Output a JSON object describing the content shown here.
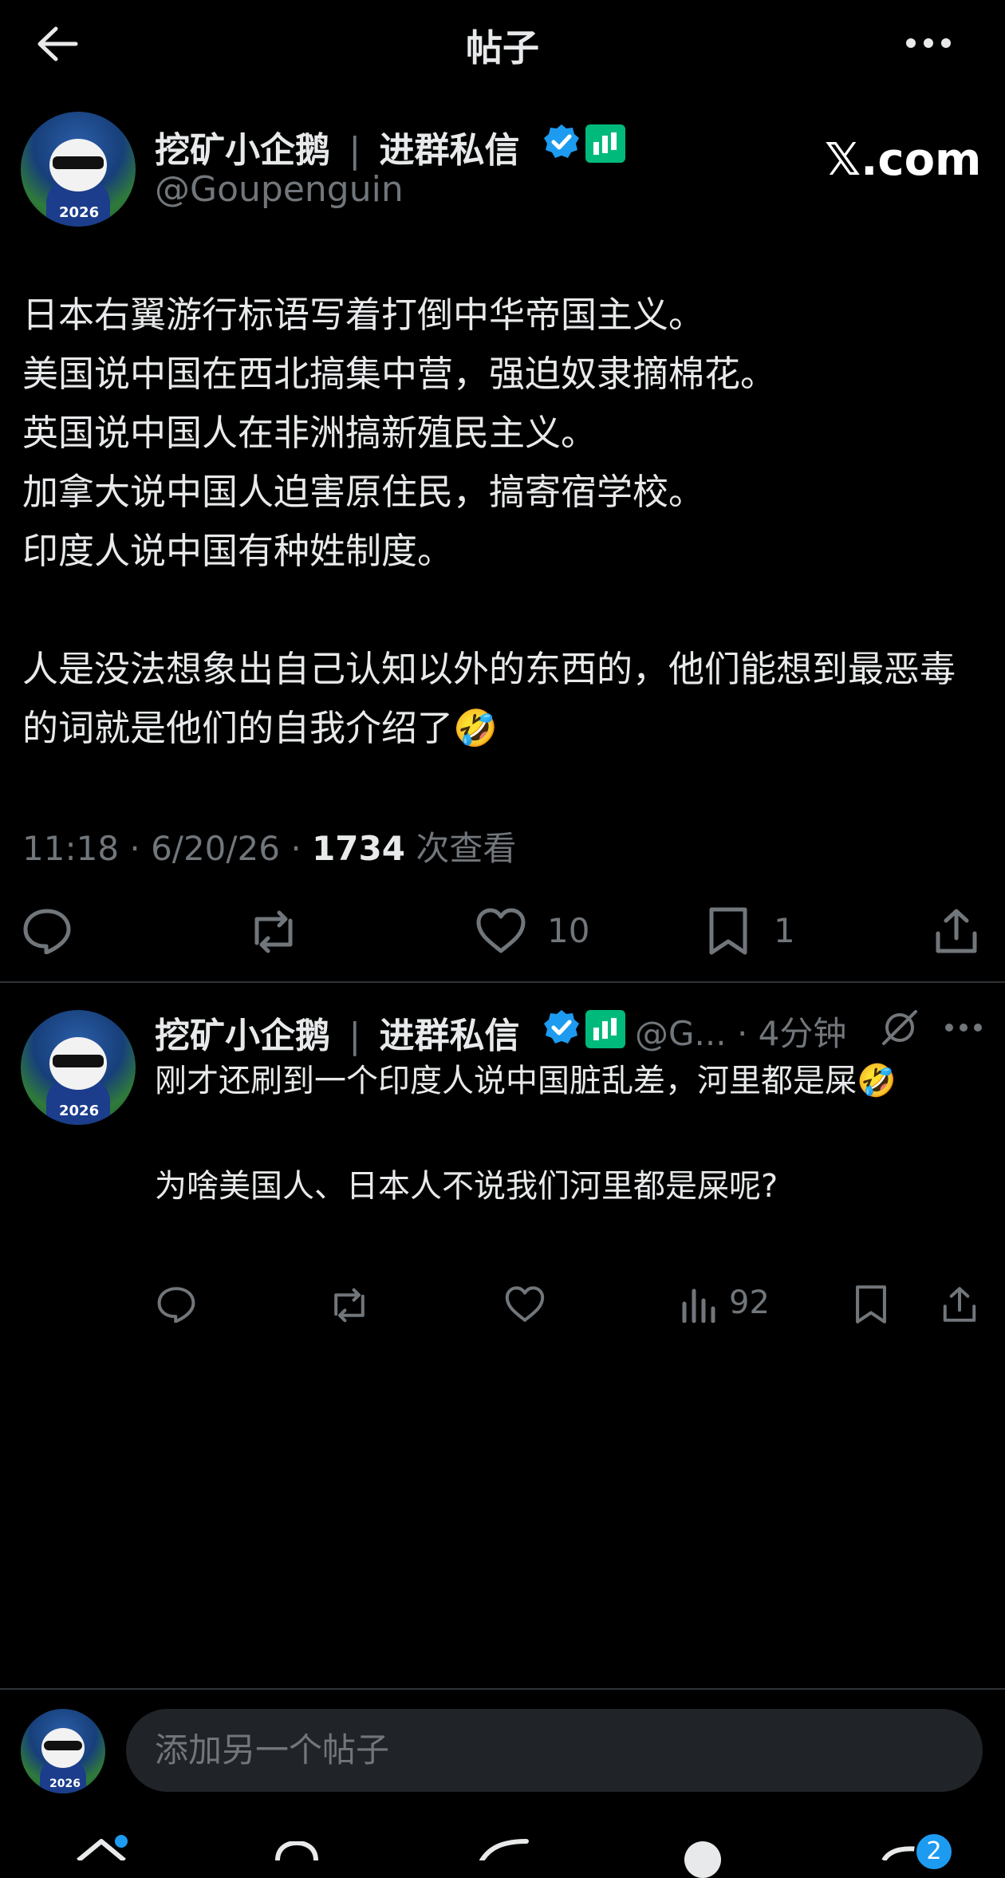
{
  "header": {
    "title": "帖子"
  },
  "post": {
    "author_name": "挖矿小企鹅",
    "name_separator": "|",
    "name_suffix": "进群私信",
    "handle": "@Goupenguin",
    "watermark": "𝕏.com",
    "avatar_text": "2026",
    "body": "日本右翼游行标语写着打倒中华帝国主义。\n美国说中国在西北搞集中营，强迫奴隶摘棉花。\n英国说中国人在非洲搞新殖民主义。\n加拿大说中国人迫害原住民，搞寄宿学校。\n印度人说中国有种姓制度。\n\n人是没法想象出自己认知以外的东西的，他们能想到最恶毒的词就是他们的自我介绍了🤣",
    "timestamp": "11:18 · 6/20/26 · ",
    "views_count": "1734",
    "views_label": " 次查看",
    "likes": "10",
    "bookmarks": "1"
  },
  "reply": {
    "author_name": "挖矿小企鹅",
    "name_separator": "|",
    "name_suffix": "进群私信",
    "handle_time": "@G... · 4分钟",
    "body": "刚才还刷到一个印度人说中国脏乱差，河里都是屎🤣\n\n为啥美国人、日本人不说我们河里都是屎呢?",
    "views": "92"
  },
  "composer": {
    "placeholder": "添加另一个帖子"
  },
  "bottom_nav": {
    "messages_badge": "2"
  },
  "colors": {
    "verified": "#1d9bf0",
    "accent_green": "#00ba7c",
    "background": "#000000"
  }
}
